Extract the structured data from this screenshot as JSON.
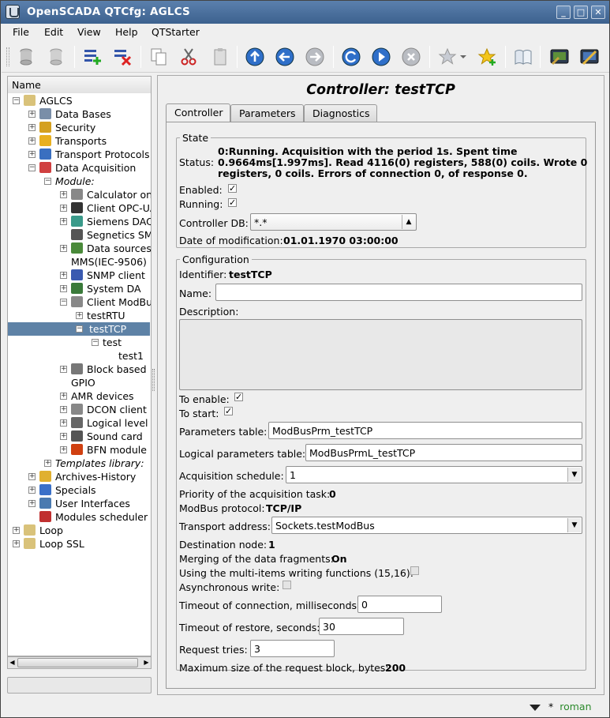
{
  "window": {
    "title": "OpenSCADA QTCfg: AGLCS"
  },
  "menu": [
    "File",
    "Edit",
    "View",
    "Help",
    "QTStarter"
  ],
  "tree": {
    "header": "Name",
    "items": [
      {
        "label": "AGLCS",
        "depth": 0,
        "exp": "-",
        "icon": "folder-icon"
      },
      {
        "label": "Data Bases",
        "depth": 1,
        "exp": "+",
        "icon": "database-icon"
      },
      {
        "label": "Security",
        "depth": 1,
        "exp": "+",
        "icon": "security-icon"
      },
      {
        "label": "Transports",
        "depth": 1,
        "exp": "+",
        "icon": "lightning-icon"
      },
      {
        "label": "Transport Protocols",
        "depth": 1,
        "exp": "+",
        "icon": "protocols-icon"
      },
      {
        "label": "Data Acquisition",
        "depth": 1,
        "exp": "-",
        "icon": "chart-icon"
      },
      {
        "label": "Module:",
        "depth": 2,
        "exp": "-",
        "icon": "",
        "italic": true
      },
      {
        "label": "Calculator on",
        "depth": 3,
        "exp": "+",
        "icon": "calculator-icon"
      },
      {
        "label": "Client OPC-UA",
        "depth": 3,
        "exp": "+",
        "icon": "opc-icon"
      },
      {
        "label": "Siemens DAQ",
        "depth": 3,
        "exp": "+",
        "icon": "siemens-icon"
      },
      {
        "label": "Segnetics SMH",
        "depth": 3,
        "exp": "",
        "icon": "device-icon"
      },
      {
        "label": "Data sources",
        "depth": 3,
        "exp": "+",
        "icon": "sources-icon"
      },
      {
        "label": "MMS(IEC-9506)",
        "depth": 3,
        "exp": "",
        "icon": ""
      },
      {
        "label": "SNMP client",
        "depth": 3,
        "exp": "+",
        "icon": "snmp-icon"
      },
      {
        "label": "System DA",
        "depth": 3,
        "exp": "+",
        "icon": "system-icon"
      },
      {
        "label": "Client ModBus",
        "depth": 3,
        "exp": "-",
        "icon": "modbus-icon"
      },
      {
        "label": "testRTU",
        "depth": 4,
        "exp": "+",
        "icon": ""
      },
      {
        "label": "testTCP",
        "depth": 4,
        "exp": "-",
        "icon": "",
        "selected": true
      },
      {
        "label": "test",
        "depth": 5,
        "exp": "-",
        "icon": ""
      },
      {
        "label": "test1",
        "depth": 6,
        "exp": "",
        "icon": ""
      },
      {
        "label": "Block based",
        "depth": 3,
        "exp": "+",
        "icon": "block-icon"
      },
      {
        "label": "GPIO",
        "depth": 3,
        "exp": "",
        "icon": ""
      },
      {
        "label": "AMR devices",
        "depth": 3,
        "exp": "+",
        "icon": ""
      },
      {
        "label": "DCON client",
        "depth": 3,
        "exp": "+",
        "icon": "dcon-icon"
      },
      {
        "label": "Logical level",
        "depth": 3,
        "exp": "+",
        "icon": "logical-icon"
      },
      {
        "label": "Sound card",
        "depth": 3,
        "exp": "+",
        "icon": "microphone-icon"
      },
      {
        "label": "BFN module",
        "depth": 3,
        "exp": "+",
        "icon": "bfn-icon"
      },
      {
        "label": "Templates library:",
        "depth": 2,
        "exp": "+",
        "icon": "",
        "italic": true
      },
      {
        "label": "Archives-History",
        "depth": 1,
        "exp": "+",
        "icon": "archive-icon"
      },
      {
        "label": "Specials",
        "depth": 1,
        "exp": "+",
        "icon": "help-icon"
      },
      {
        "label": "User Interfaces",
        "depth": 1,
        "exp": "+",
        "icon": "monitor-icon"
      },
      {
        "label": "Modules scheduler",
        "depth": 1,
        "exp": "",
        "icon": "scheduler-icon"
      },
      {
        "label": "Loop",
        "depth": 0,
        "exp": "+",
        "icon": "folder-icon"
      },
      {
        "label": "Loop SSL",
        "depth": 0,
        "exp": "+",
        "icon": "folder-icon"
      }
    ]
  },
  "page": {
    "title": "Controller: testTCP"
  },
  "tabs": [
    "Controller",
    "Parameters",
    "Diagnostics"
  ],
  "state": {
    "legend": "State",
    "status_label": "Status:",
    "status_lines": [
      "0:Running. Acquisition with the period 1s. Spent time",
      "0.9664ms[1.997ms]. Read 4116(0) registers, 588(0) coils. Wrote 0",
      "registers, 0 coils. Errors of connection 0, of response 0."
    ],
    "enabled_label": "Enabled:",
    "running_label": "Running:",
    "db_label": "Controller DB:",
    "db_value": "*.*",
    "date_label": "Date of modification:",
    "date_value": "01.01.1970 03:00:00"
  },
  "config": {
    "legend": "Configuration",
    "identifier_label": "Identifier:",
    "identifier_value": "testTCP",
    "name_label": "Name:",
    "name_value": "",
    "description_label": "Description:",
    "to_enable_label": "To enable:",
    "to_start_label": "To start:",
    "params_table_label": "Parameters table:",
    "params_table_value": "ModBusPrm_testTCP",
    "log_params_table_label": "Logical parameters table:",
    "log_params_table_value": "ModBusPrmL_testTCP",
    "schedule_label": "Acquisition schedule:",
    "schedule_value": "1",
    "priority_label": "Priority of the acquisition task:",
    "priority_value": "0",
    "protocol_label": "ModBus protocol:",
    "protocol_value": "TCP/IP",
    "transport_label": "Transport address:",
    "transport_value": "Sockets.testModBus",
    "dest_label": "Destination node:",
    "dest_value": "1",
    "merge_label": "Merging of the data fragments:",
    "merge_value": "On",
    "multi_label": "Using the multi-items writing functions (15,16):",
    "async_label": "Asynchronous write:",
    "timeout_conn_label": "Timeout of connection, milliseconds:",
    "timeout_conn_value": "0",
    "timeout_rest_label": "Timeout of restore, seconds:",
    "timeout_rest_value": "30",
    "tries_label": "Request tries:",
    "tries_value": "3",
    "maxsize_label": "Maximum size of the request block, bytes:",
    "maxsize_value": "200"
  },
  "statusbar": {
    "user": "roman",
    "modified_mark": "*"
  }
}
